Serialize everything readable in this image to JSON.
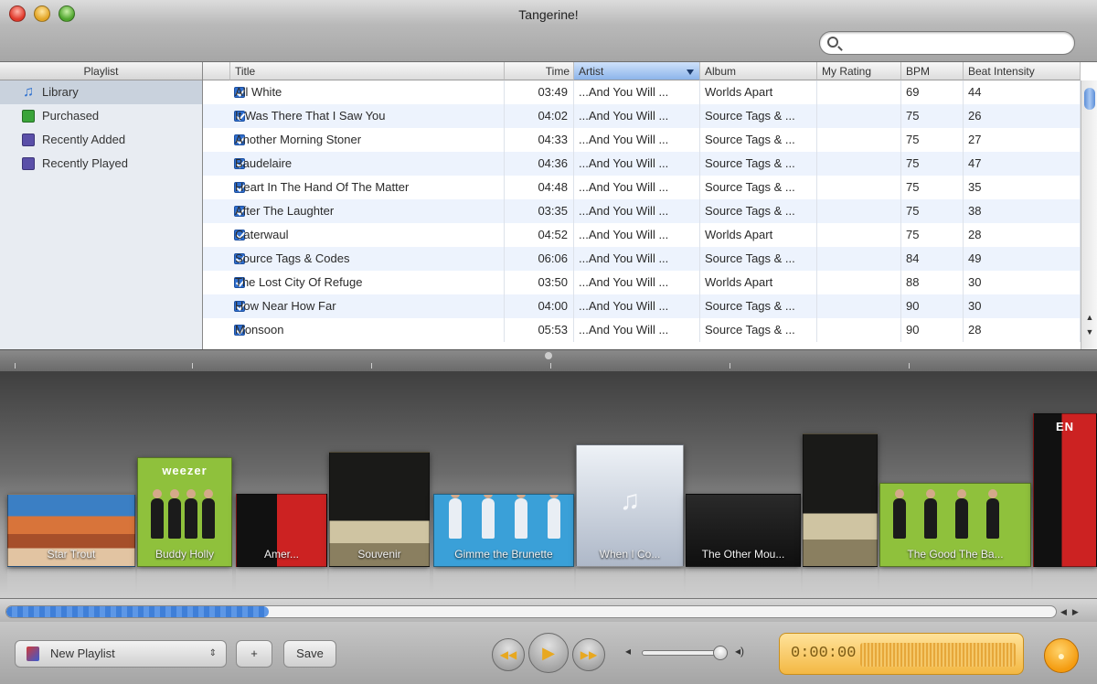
{
  "window": {
    "title": "Tangerine!"
  },
  "search": {
    "placeholder": "",
    "value": ""
  },
  "sidebar": {
    "header": "Playlist",
    "items": [
      {
        "label": "Library",
        "icon": "music-note-icon",
        "selected": true
      },
      {
        "label": "Purchased",
        "icon": "purchased-playlist-icon"
      },
      {
        "label": "Recently Added",
        "icon": "smart-playlist-icon"
      },
      {
        "label": "Recently Played",
        "icon": "smart-playlist-icon"
      }
    ]
  },
  "tracklist": {
    "columns": [
      "Title",
      "Time",
      "Artist",
      "Album",
      "My Rating",
      "BPM",
      "Beat Intensity"
    ],
    "sorted_column": "Artist",
    "rows": [
      {
        "title": "All White",
        "time": "03:49",
        "artist": "...And You Will ...",
        "album": "Worlds Apart",
        "rating": "",
        "bpm": "69",
        "beat": "44"
      },
      {
        "title": "It Was There That I Saw You",
        "time": "04:02",
        "artist": "...And You Will ...",
        "album": "Source Tags & ...",
        "rating": "",
        "bpm": "75",
        "beat": "26"
      },
      {
        "title": "Another Morning Stoner",
        "time": "04:33",
        "artist": "...And You Will ...",
        "album": "Source Tags & ...",
        "rating": "",
        "bpm": "75",
        "beat": "27"
      },
      {
        "title": "Baudelaire",
        "time": "04:36",
        "artist": "...And You Will ...",
        "album": "Source Tags & ...",
        "rating": "",
        "bpm": "75",
        "beat": "47"
      },
      {
        "title": "Heart In The Hand Of The Matter",
        "time": "04:48",
        "artist": "...And You Will ...",
        "album": "Source Tags & ...",
        "rating": "",
        "bpm": "75",
        "beat": "35"
      },
      {
        "title": "After The Laughter",
        "time": "03:35",
        "artist": "...And You Will ...",
        "album": "Source Tags & ...",
        "rating": "",
        "bpm": "75",
        "beat": "38"
      },
      {
        "title": "Caterwaul",
        "time": "04:52",
        "artist": "...And You Will ...",
        "album": "Worlds Apart",
        "rating": "",
        "bpm": "75",
        "beat": "28"
      },
      {
        "title": "Source Tags & Codes",
        "time": "06:06",
        "artist": "...And You Will ...",
        "album": "Source Tags & ...",
        "rating": "",
        "bpm": "84",
        "beat": "49"
      },
      {
        "title": "The Lost City Of Refuge",
        "time": "03:50",
        "artist": "...And You Will ...",
        "album": "Worlds Apart",
        "rating": "",
        "bpm": "88",
        "beat": "30"
      },
      {
        "title": "How Near How Far",
        "time": "04:00",
        "artist": "...And You Will ...",
        "album": "Source Tags & ...",
        "rating": "",
        "bpm": "90",
        "beat": "30"
      },
      {
        "title": "Monsoon",
        "time": "05:53",
        "artist": "...And You Will ...",
        "album": "Source Tags & ...",
        "rating": "",
        "bpm": "90",
        "beat": "28"
      }
    ]
  },
  "albums": [
    {
      "label": "Star Trout",
      "style": "desert",
      "bg": "#3b7fc4"
    },
    {
      "label": "Buddy Holly",
      "style": "band-green",
      "bg": "#8fc13c",
      "badge": "weezer"
    },
    {
      "label": "Amer...",
      "style": "red-poster",
      "bg": "#1b1b1b"
    },
    {
      "label": "Souvenir",
      "style": "rubble",
      "bg": "#2b2b25"
    },
    {
      "label": "Gimme the Brunette",
      "style": "band-blue",
      "bg": "#3aa0d8"
    },
    {
      "label": "When I Co...",
      "style": "placeholder",
      "bg": "#c5cfdd"
    },
    {
      "label": "The Other Mou...",
      "style": "dark-script",
      "bg": "#222"
    },
    {
      "label": "",
      "style": "rubble",
      "bg": "#2b2b25"
    },
    {
      "label": "The Good The Ba...",
      "style": "band-green2",
      "bg": "#8fc13c"
    },
    {
      "label": "",
      "style": "red-poster-big",
      "bg": "#111",
      "badge": "EN"
    }
  ],
  "progress": {
    "fraction": 0.25
  },
  "bottom": {
    "playlist_select": "New Playlist",
    "add_label": "+",
    "save_label": "Save",
    "time": "0:00:00"
  }
}
